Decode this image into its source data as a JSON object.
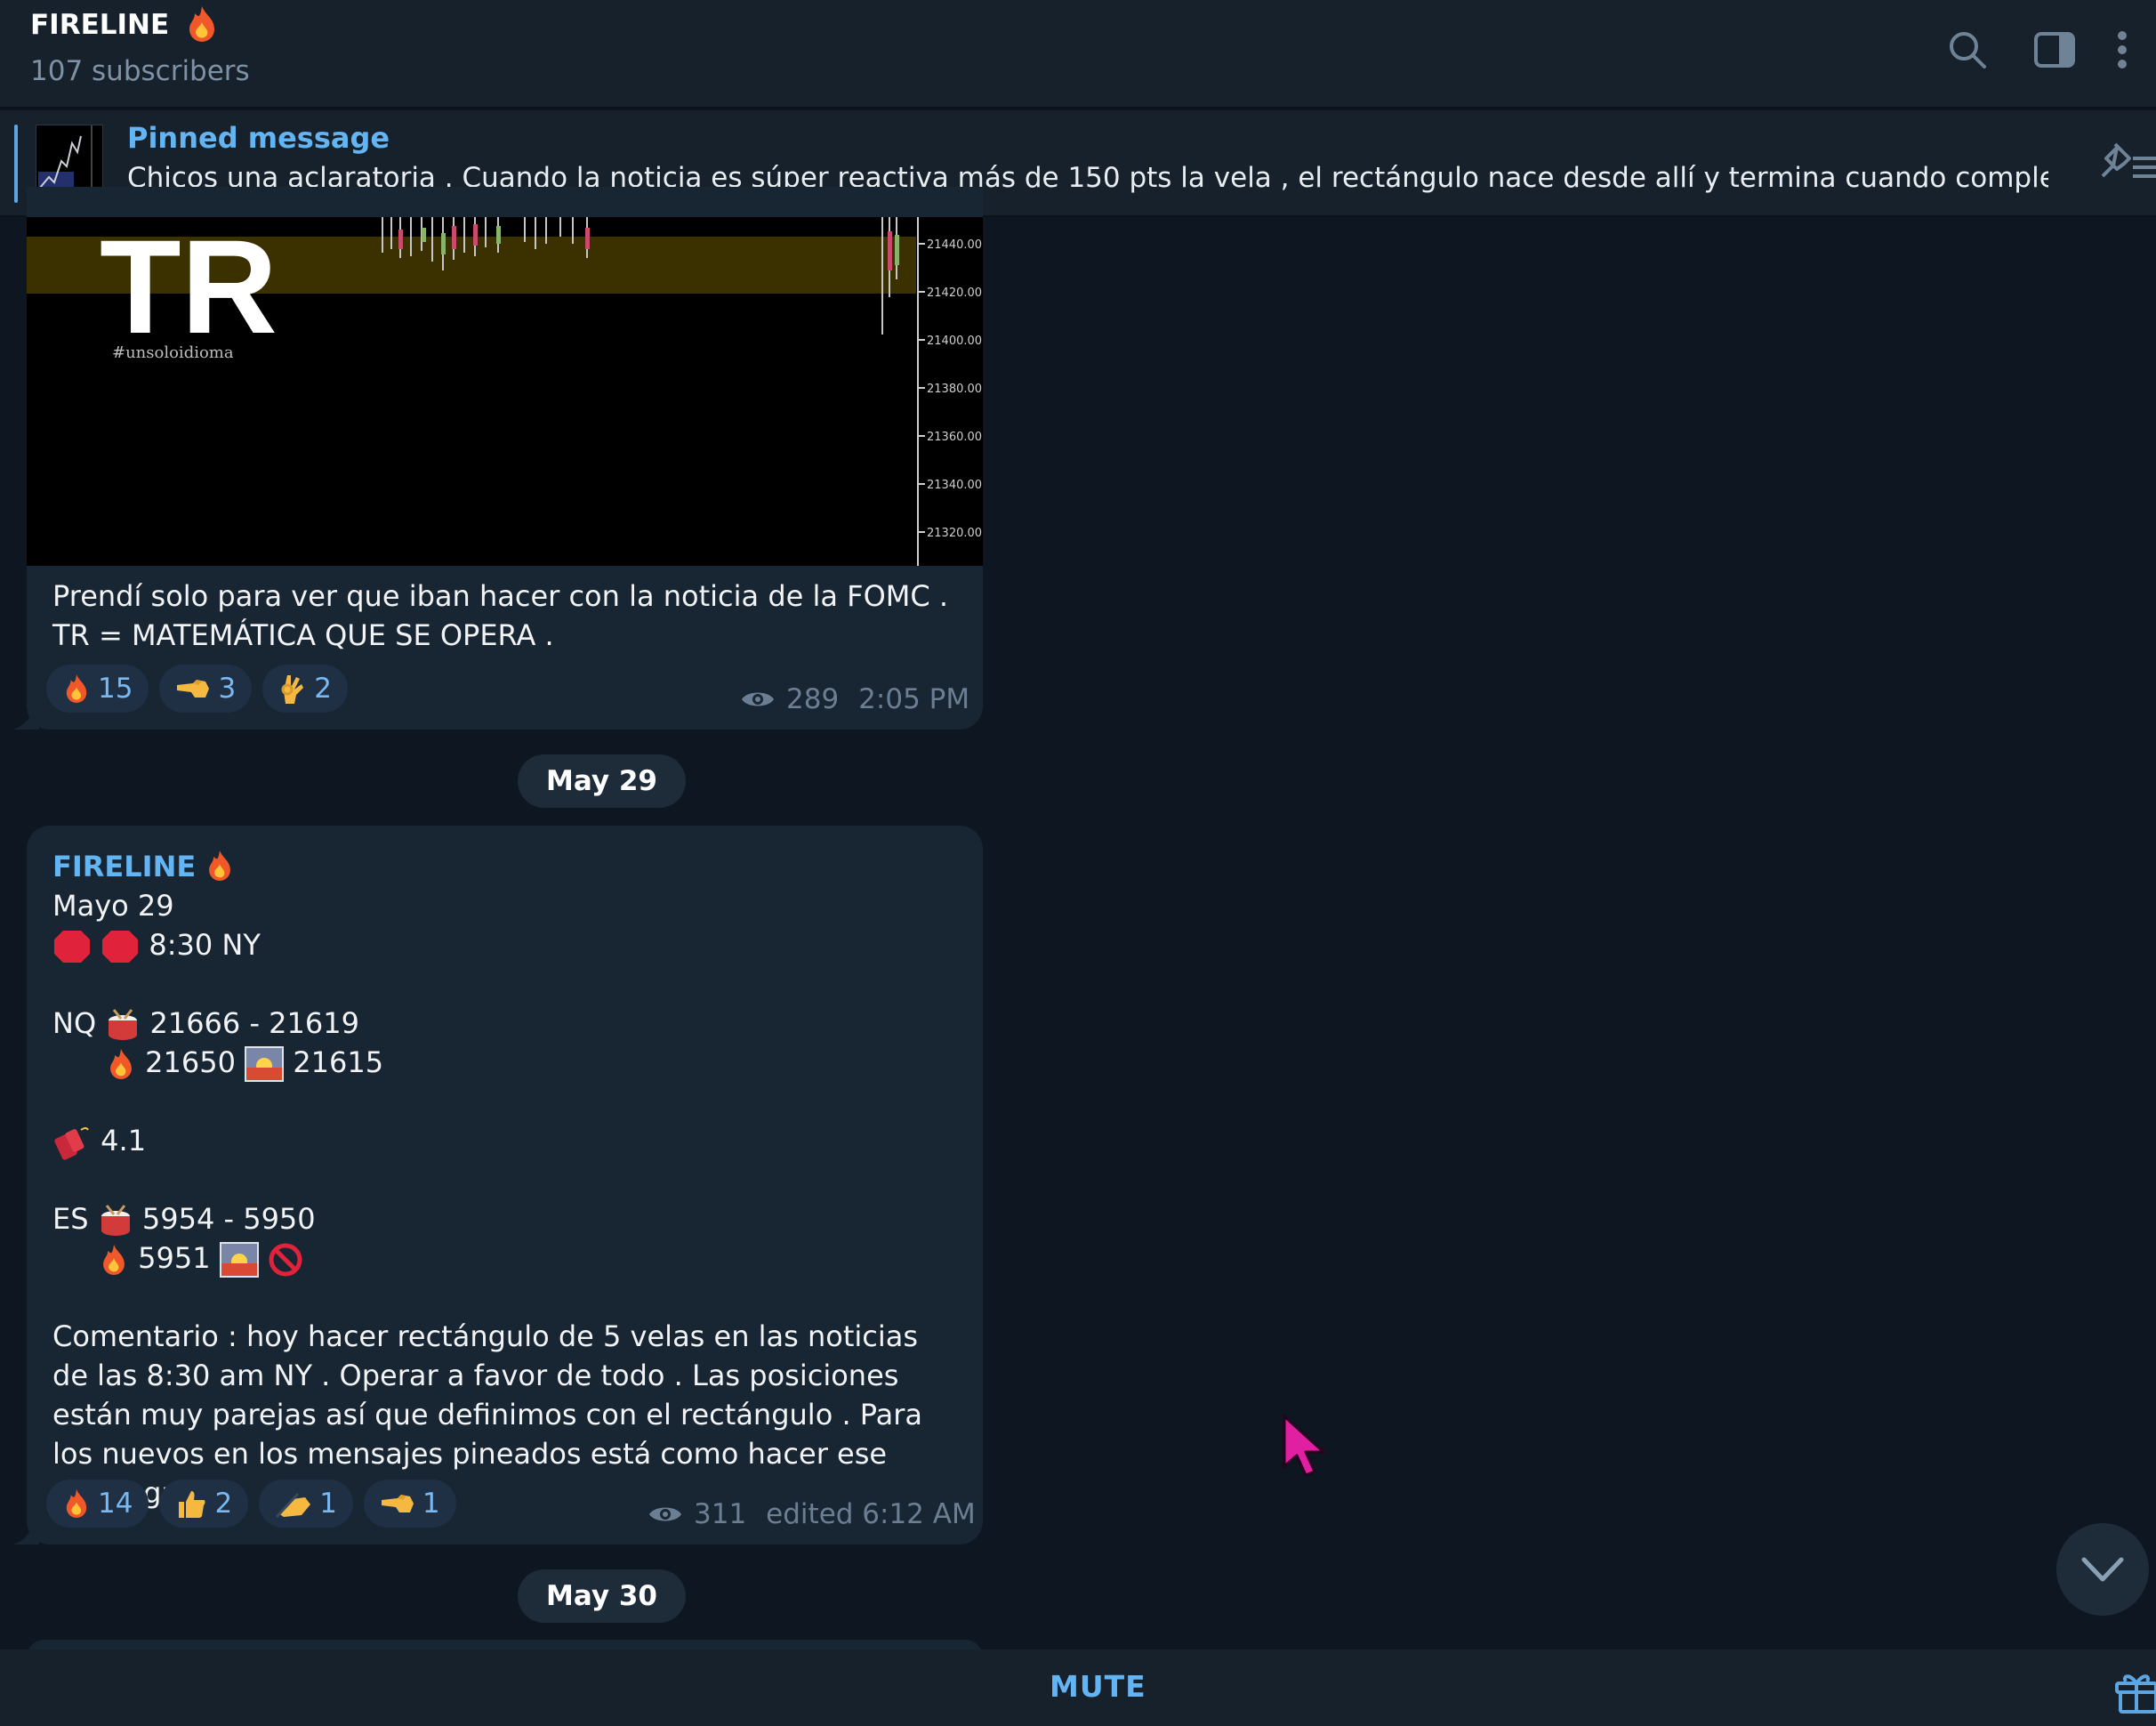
{
  "header": {
    "title": "FIRELINE",
    "subtitle": "107 subscribers"
  },
  "pinned": {
    "label": "Pinned message",
    "text": "Chicos una aclaratoria .  Cuando la noticia es súper reactiva más de 150 pts la vela , el rectángulo nace desde allí y termina cuando complete las..."
  },
  "message1": {
    "image": {
      "logo": "TR",
      "hashtag": "#unsoloidioma",
      "price_labels": [
        "21440.00",
        "21420.00",
        "21400.00",
        "21380.00",
        "21360.00",
        "21340.00",
        "21320.00"
      ]
    },
    "text": "Prendí solo para ver que iban hacer con la noticia de la FOMC . TR = MATEMÁTICA QUE SE OPERA .",
    "reactions": [
      {
        "emoji": "fire",
        "count": "15"
      },
      {
        "emoji": "point-left",
        "count": "3"
      },
      {
        "emoji": "ok-hand",
        "count": "2"
      }
    ],
    "views": "289",
    "time": "2:05 PM"
  },
  "date1": "May 29",
  "message2": {
    "sender": "FIRELINE",
    "line1": "Mayo 29",
    "line2": "8:30 NY",
    "nq_label": "NQ",
    "nq_range": "21666 - 21619",
    "nq_fire": "21650",
    "nq_target": "21615",
    "dynamite": "4.1",
    "es_label": "ES",
    "es_range": "5954 - 5950",
    "es_fire": "5951",
    "comment": "Comentario : hoy hacer rectángulo  de 5 velas en las noticias de las 8:30 am NY . Operar a favor de todo . Las posiciones están muy parejas así que definimos con el rectángulo .  Para los nuevos en los mensajes pineados está como hacer ese rectángulo .",
    "reactions": [
      {
        "emoji": "fire",
        "count": "14"
      },
      {
        "emoji": "thumbs-up",
        "count": "2"
      },
      {
        "emoji": "writing-hand",
        "count": "1"
      },
      {
        "emoji": "point-left",
        "count": "1"
      }
    ],
    "views": "311",
    "time": "edited 6:12 AM"
  },
  "date2": "May 30",
  "bottom": {
    "mute": "MUTE"
  }
}
